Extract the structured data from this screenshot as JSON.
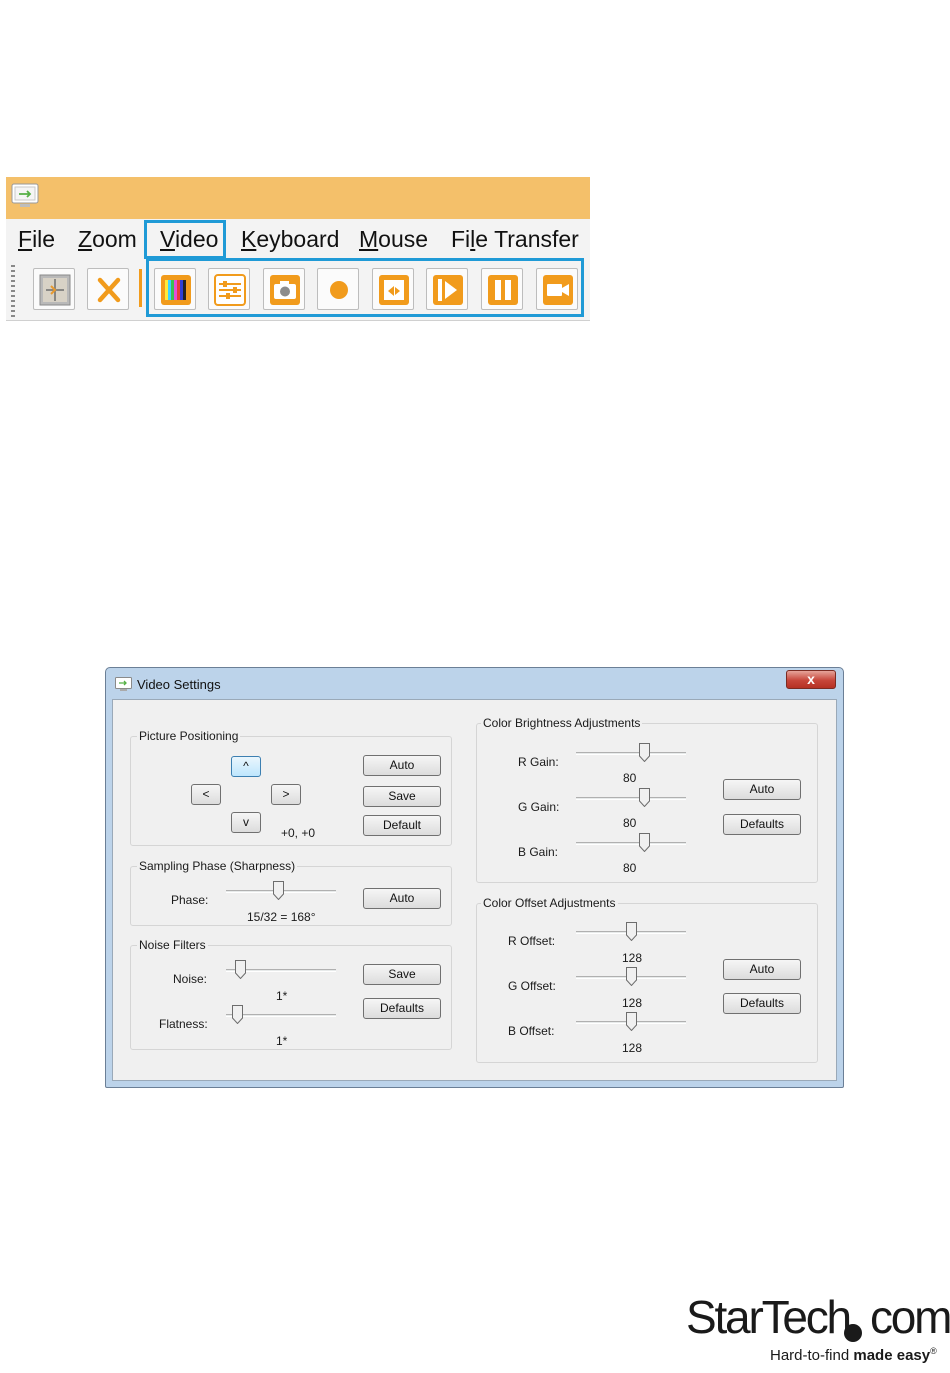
{
  "menu": {
    "items": [
      {
        "pre": "",
        "ul": "F",
        "post": "ile"
      },
      {
        "pre": "",
        "ul": "Z",
        "post": "oom"
      },
      {
        "pre": "",
        "ul": "V",
        "post": "ideo"
      },
      {
        "pre": "",
        "ul": "K",
        "post": "eyboard"
      },
      {
        "pre": "",
        "ul": "M",
        "post": "ouse"
      },
      {
        "pre": "Fi",
        "ul": "l",
        "post": "e Transfer"
      }
    ]
  },
  "toolbar": {
    "icons": [
      "full-screen-icon",
      "exit-icon",
      "video-settings-icon",
      "adjustments-icon",
      "snapshot-icon",
      "record-icon",
      "video-capture-icon",
      "play-icon",
      "pause-icon",
      "camera-icon"
    ],
    "accent": "#f19b1c",
    "highlight": "#1f9ad6"
  },
  "dialog": {
    "title": "Video Settings",
    "close_label": "x",
    "picture_positioning": {
      "title": "Picture Positioning",
      "up": "^",
      "left": "<",
      "right": ">",
      "down": "v",
      "position_value": "+0,  +0",
      "auto": "Auto",
      "save": "Save",
      "default": "Default"
    },
    "sampling_phase": {
      "title": "Sampling Phase (Sharpness)",
      "phase_label": "Phase:",
      "phase_value": "15/32 = 168°",
      "phase_level": 15,
      "phase_max": 32,
      "auto": "Auto"
    },
    "noise_filters": {
      "title": "Noise Filters",
      "noise_label": "Noise:",
      "noise_value": "1*",
      "flatness_label": "Flatness:",
      "flatness_value": "1*",
      "save": "Save",
      "defaults": "Defaults"
    },
    "color_brightness": {
      "title": "Color Brightness Adjustments",
      "r_label": "R Gain:",
      "r_value": "80",
      "g_label": "G Gain:",
      "g_value": "80",
      "b_label": "B Gain:",
      "b_value": "80",
      "auto": "Auto",
      "defaults": "Defaults"
    },
    "color_offset": {
      "title": "Color Offset Adjustments",
      "r_label": "R Offset:",
      "r_value": "128",
      "g_label": "G Offset:",
      "g_value": "128",
      "b_label": "B Offset:",
      "b_value": "128",
      "auto": "Auto",
      "defaults": "Defaults"
    }
  },
  "logo": {
    "brand": "StarTech",
    "suffix": "com",
    "tagline_plain": "Hard-to-find ",
    "tagline_bold": "made easy",
    "registered": "®"
  }
}
